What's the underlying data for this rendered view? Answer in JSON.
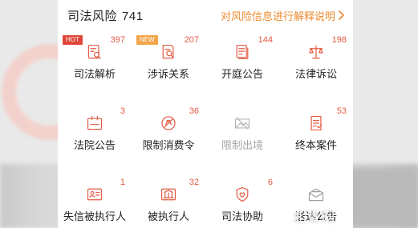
{
  "header": {
    "title": "司法风险",
    "total": "741",
    "explain_link": "对风险信息进行解释说明"
  },
  "colors": {
    "accent": "#e35a44",
    "link": "#ec8a2e",
    "hot_tag": "#e0463a",
    "new_tag": "#f3a54a",
    "disabled_text": "#a6a6a6"
  },
  "items": [
    {
      "label": "司法解析",
      "count": "397",
      "tag": "HOT",
      "icon": "judicial-analysis-icon"
    },
    {
      "label": "涉诉关系",
      "count": "207",
      "tag": "NEW",
      "icon": "litigation-relation-icon"
    },
    {
      "label": "开庭公告",
      "count": "144",
      "tag": "",
      "icon": "court-session-icon"
    },
    {
      "label": "法律诉讼",
      "count": "198",
      "tag": "",
      "icon": "scales-icon"
    },
    {
      "label": "法院公告",
      "count": "3",
      "tag": "",
      "icon": "court-announcement-icon"
    },
    {
      "label": "限制消费令",
      "count": "36",
      "tag": "",
      "icon": "restricted-consumption-icon"
    },
    {
      "label": "限制出境",
      "count": "",
      "tag": "",
      "icon": "exit-restriction-icon"
    },
    {
      "label": "终本案件",
      "count": "53",
      "tag": "",
      "icon": "final-case-icon"
    },
    {
      "label": "失信被执行人",
      "count": "1",
      "tag": "",
      "icon": "dishonest-person-icon"
    },
    {
      "label": "被执行人",
      "count": "32",
      "tag": "",
      "icon": "executed-person-icon"
    },
    {
      "label": "司法协助",
      "count": "6",
      "tag": "",
      "icon": "judicial-assistance-icon"
    },
    {
      "label": "送达公告",
      "count": "",
      "tag": "",
      "icon": "delivery-notice-icon"
    }
  ],
  "watermark": "北青网"
}
